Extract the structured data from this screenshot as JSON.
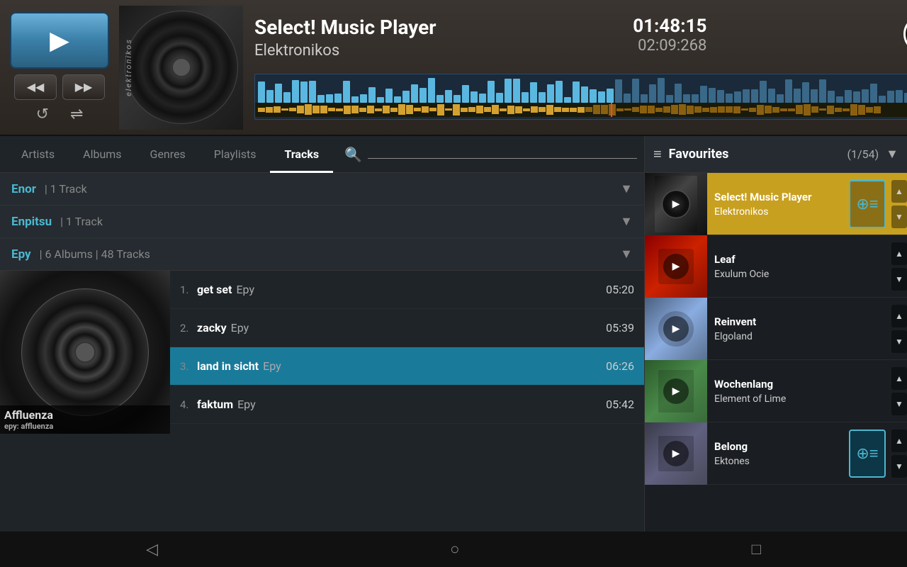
{
  "app": {
    "title": "Select! Music Player"
  },
  "player": {
    "track_title": "Select! Music Player",
    "artist": "Elektronikos",
    "time_current": "01:48:15",
    "time_total": "02:09:268",
    "album": "Elektronikos",
    "play_button_label": "▶",
    "prev_label": "⏮",
    "next_label": "⏭",
    "repeat_label": "↺",
    "shuffle_label": "⇌",
    "info_label": "i"
  },
  "tabs": {
    "items": [
      {
        "id": "artists",
        "label": "Artists",
        "active": false
      },
      {
        "id": "albums",
        "label": "Albums",
        "active": false
      },
      {
        "id": "genres",
        "label": "Genres",
        "active": false
      },
      {
        "id": "playlists",
        "label": "Playlists",
        "active": false
      },
      {
        "id": "tracks",
        "label": "Tracks",
        "active": true
      }
    ]
  },
  "library": {
    "artists": [
      {
        "name": "Enor",
        "track_count": "1 Track",
        "album_count": null,
        "expanded": false
      },
      {
        "name": "Enpitsu",
        "track_count": "1 Track",
        "album_count": null,
        "expanded": false
      },
      {
        "name": "Epy",
        "track_count": "48 Tracks",
        "album_count": "6 Albums",
        "expanded": true,
        "album": {
          "title": "Affluenza",
          "subtitle": "epy: affluenza"
        },
        "tracks": [
          {
            "num": "1.",
            "name": "get set",
            "artist": "Epy",
            "duration": "05:20",
            "playing": false
          },
          {
            "num": "2.",
            "name": "zacky",
            "artist": "Epy",
            "duration": "05:39",
            "playing": false
          },
          {
            "num": "3.",
            "name": "land in sicht",
            "artist": "Epy",
            "duration": "06:26",
            "playing": true
          },
          {
            "num": "4.",
            "name": "faktum",
            "artist": "Epy",
            "duration": "05:42",
            "playing": false
          }
        ]
      }
    ]
  },
  "favourites": {
    "title": "Favourites",
    "count": "(1/54)",
    "items": [
      {
        "id": "select-music-player",
        "track": "Select! Music Player",
        "artist": "Elektronikos",
        "thumb_class": "thumb-elektronikos",
        "active": true
      },
      {
        "id": "leaf",
        "track": "Leaf",
        "artist": "Exulum Ocie",
        "thumb_class": "thumb-leaf",
        "active": false
      },
      {
        "id": "reinvent",
        "track": "Reinvent",
        "artist": "Elgoland",
        "thumb_class": "thumb-reinvent",
        "active": false
      },
      {
        "id": "wochenlang",
        "track": "Wochenlang",
        "artist": "Element of Lime",
        "thumb_class": "thumb-wochenlang",
        "active": false
      },
      {
        "id": "belong",
        "track": "Belong",
        "artist": "Ektones",
        "thumb_class": "thumb-belong",
        "active": false
      }
    ]
  },
  "nav": {
    "back": "◁",
    "home": "○",
    "recent": "□"
  }
}
